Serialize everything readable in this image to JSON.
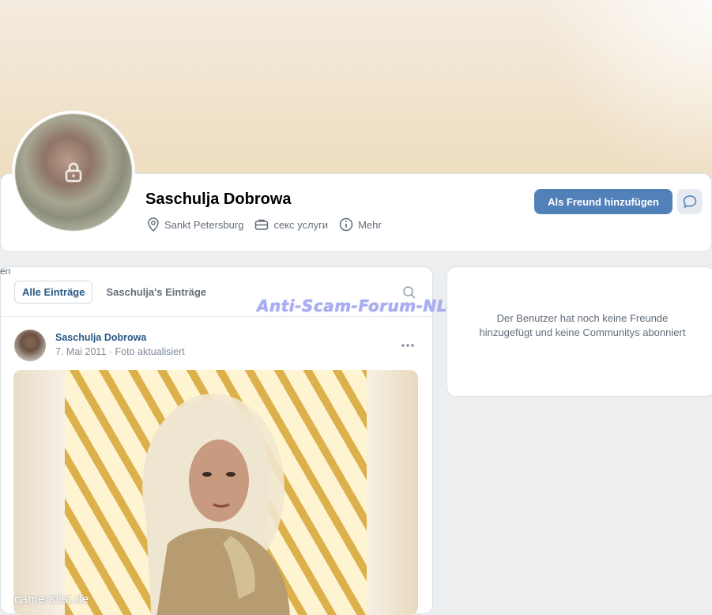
{
  "profile": {
    "name": "Saschulja Dobrowa",
    "location": "Sankt Petersburg",
    "occupation": "секс услуги",
    "more_label": "Mehr",
    "add_friend_label": "Als Freund hinzufügen"
  },
  "feed": {
    "left_cut_text": "en",
    "tabs": [
      {
        "label": "Alle Einträge",
        "active": true
      },
      {
        "label": "Saschulja's Einträge",
        "active": false
      }
    ],
    "post": {
      "author": "Saschulja Dobrowa",
      "date": "7. Mai 2011",
      "action": "Foto aktualisiert"
    }
  },
  "sidebar": {
    "empty_text": "Der Benutzer hat noch keine Freunde hinzugefügt und keine Communitys abonniert"
  },
  "overlays": {
    "watermark": "Anti-Scam-Forum-NL",
    "corner_mark": "camerslist.de"
  },
  "colors": {
    "accent": "#5181b8",
    "link": "#2a5885",
    "muted": "#626d7a"
  }
}
